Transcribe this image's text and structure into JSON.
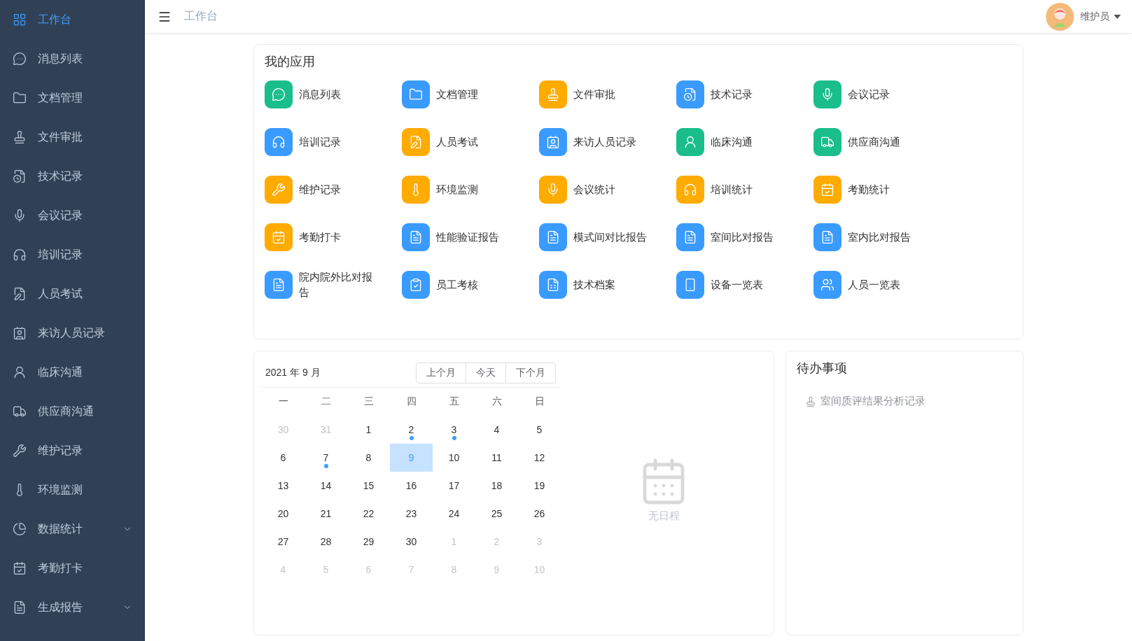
{
  "sidebar": {
    "items": [
      {
        "label": "工作台",
        "selected": true,
        "kind": "link"
      },
      {
        "label": "消息列表",
        "selected": false,
        "kind": "link"
      },
      {
        "label": "文档管理",
        "selected": false,
        "kind": "link"
      },
      {
        "label": "文件审批",
        "selected": false,
        "kind": "link"
      },
      {
        "label": "技术记录",
        "selected": false,
        "kind": "link"
      },
      {
        "label": "会议记录",
        "selected": false,
        "kind": "link"
      },
      {
        "label": "培训记录",
        "selected": false,
        "kind": "link"
      },
      {
        "label": "人员考试",
        "selected": false,
        "kind": "link"
      },
      {
        "label": "来访人员记录",
        "selected": false,
        "kind": "link"
      },
      {
        "label": "临床沟通",
        "selected": false,
        "kind": "link"
      },
      {
        "label": "供应商沟通",
        "selected": false,
        "kind": "link"
      },
      {
        "label": "维护记录",
        "selected": false,
        "kind": "link"
      },
      {
        "label": "环境监测",
        "selected": false,
        "kind": "link"
      },
      {
        "label": "数据统计",
        "selected": false,
        "kind": "submenu"
      },
      {
        "label": "考勤打卡",
        "selected": false,
        "kind": "link"
      },
      {
        "label": "生成报告",
        "selected": false,
        "kind": "submenu"
      }
    ]
  },
  "header": {
    "breadcrumb": "工作台",
    "user": "维护员"
  },
  "apps": {
    "title": "我的应用",
    "items": [
      {
        "label": "消息列表",
        "color": "#19be8b"
      },
      {
        "label": "文档管理",
        "color": "#3a9bff"
      },
      {
        "label": "文件审批",
        "color": "#ffab00"
      },
      {
        "label": "技术记录",
        "color": "#3a9bff"
      },
      {
        "label": "会议记录",
        "color": "#19be8b"
      },
      {
        "label": "培训记录",
        "color": "#3a9bff"
      },
      {
        "label": "人员考试",
        "color": "#ffab00"
      },
      {
        "label": "来访人员记录",
        "color": "#3a9bff"
      },
      {
        "label": "临床沟通",
        "color": "#19be8b"
      },
      {
        "label": "供应商沟通",
        "color": "#19be8b"
      },
      {
        "label": "维护记录",
        "color": "#ffab00"
      },
      {
        "label": "环境监测",
        "color": "#ffab00"
      },
      {
        "label": "会议统计",
        "color": "#ffab00"
      },
      {
        "label": "培训统计",
        "color": "#ffab00"
      },
      {
        "label": "考勤统计",
        "color": "#ffab00"
      },
      {
        "label": "考勤打卡",
        "color": "#ffab00"
      },
      {
        "label": "性能验证报告",
        "color": "#3a9bff"
      },
      {
        "label": "模式间对比报告",
        "color": "#3a9bff"
      },
      {
        "label": "室间比对报告",
        "color": "#3a9bff"
      },
      {
        "label": "室内比对报告",
        "color": "#3a9bff"
      },
      {
        "label": "院内院外比对报告",
        "color": "#3a9bff"
      },
      {
        "label": "员工考核",
        "color": "#3a9bff"
      },
      {
        "label": "技术档案",
        "color": "#3a9bff"
      },
      {
        "label": "设备一览表",
        "color": "#3a9bff"
      },
      {
        "label": "人员一览表",
        "color": "#3a9bff"
      }
    ]
  },
  "calendar": {
    "title": "2021 年 9 月",
    "buttons": [
      "上个月",
      "今天",
      "下个月"
    ],
    "weekdays": [
      "一",
      "二",
      "三",
      "四",
      "五",
      "六",
      "日"
    ],
    "days": [
      {
        "day": "30",
        "other_month": true,
        "selected": false,
        "event": false
      },
      {
        "day": "31",
        "other_month": true,
        "selected": false,
        "event": false
      },
      {
        "day": "1",
        "other_month": false,
        "selected": false,
        "event": false
      },
      {
        "day": "2",
        "other_month": false,
        "selected": false,
        "event": true
      },
      {
        "day": "3",
        "other_month": false,
        "selected": false,
        "event": true
      },
      {
        "day": "4",
        "other_month": false,
        "selected": false,
        "event": false
      },
      {
        "day": "5",
        "other_month": false,
        "selected": false,
        "event": false
      },
      {
        "day": "6",
        "other_month": false,
        "selected": false,
        "event": false
      },
      {
        "day": "7",
        "other_month": false,
        "selected": false,
        "event": true
      },
      {
        "day": "8",
        "other_month": false,
        "selected": false,
        "event": false
      },
      {
        "day": "9",
        "other_month": false,
        "selected": true,
        "event": false
      },
      {
        "day": "10",
        "other_month": false,
        "selected": false,
        "event": false
      },
      {
        "day": "11",
        "other_month": false,
        "selected": false,
        "event": false
      },
      {
        "day": "12",
        "other_month": false,
        "selected": false,
        "event": false
      },
      {
        "day": "13",
        "other_month": false,
        "selected": false,
        "event": false
      },
      {
        "day": "14",
        "other_month": false,
        "selected": false,
        "event": false
      },
      {
        "day": "15",
        "other_month": false,
        "selected": false,
        "event": false
      },
      {
        "day": "16",
        "other_month": false,
        "selected": false,
        "event": false
      },
      {
        "day": "17",
        "other_month": false,
        "selected": false,
        "event": false
      },
      {
        "day": "18",
        "other_month": false,
        "selected": false,
        "event": false
      },
      {
        "day": "19",
        "other_month": false,
        "selected": false,
        "event": false
      },
      {
        "day": "20",
        "other_month": false,
        "selected": false,
        "event": false
      },
      {
        "day": "21",
        "other_month": false,
        "selected": false,
        "event": false
      },
      {
        "day": "22",
        "other_month": false,
        "selected": false,
        "event": false
      },
      {
        "day": "23",
        "other_month": false,
        "selected": false,
        "event": false
      },
      {
        "day": "24",
        "other_month": false,
        "selected": false,
        "event": false
      },
      {
        "day": "25",
        "other_month": false,
        "selected": false,
        "event": false
      },
      {
        "day": "26",
        "other_month": false,
        "selected": false,
        "event": false
      },
      {
        "day": "27",
        "other_month": false,
        "selected": false,
        "event": false
      },
      {
        "day": "28",
        "other_month": false,
        "selected": false,
        "event": false
      },
      {
        "day": "29",
        "other_month": false,
        "selected": false,
        "event": false
      },
      {
        "day": "30",
        "other_month": false,
        "selected": false,
        "event": false
      },
      {
        "day": "1",
        "other_month": true,
        "selected": false,
        "event": false
      },
      {
        "day": "2",
        "other_month": true,
        "selected": false,
        "event": false
      },
      {
        "day": "3",
        "other_month": true,
        "selected": false,
        "event": false
      },
      {
        "day": "4",
        "other_month": true,
        "selected": false,
        "event": false
      },
      {
        "day": "5",
        "other_month": true,
        "selected": false,
        "event": false
      },
      {
        "day": "6",
        "other_month": true,
        "selected": false,
        "event": false
      },
      {
        "day": "7",
        "other_month": true,
        "selected": false,
        "event": false
      },
      {
        "day": "8",
        "other_month": true,
        "selected": false,
        "event": false
      },
      {
        "day": "9",
        "other_month": true,
        "selected": false,
        "event": false
      },
      {
        "day": "10",
        "other_month": true,
        "selected": false,
        "event": false
      }
    ],
    "empty_text": "无日程"
  },
  "todo": {
    "title": "待办事项",
    "items": [
      "室间质评结果分析记录"
    ]
  }
}
